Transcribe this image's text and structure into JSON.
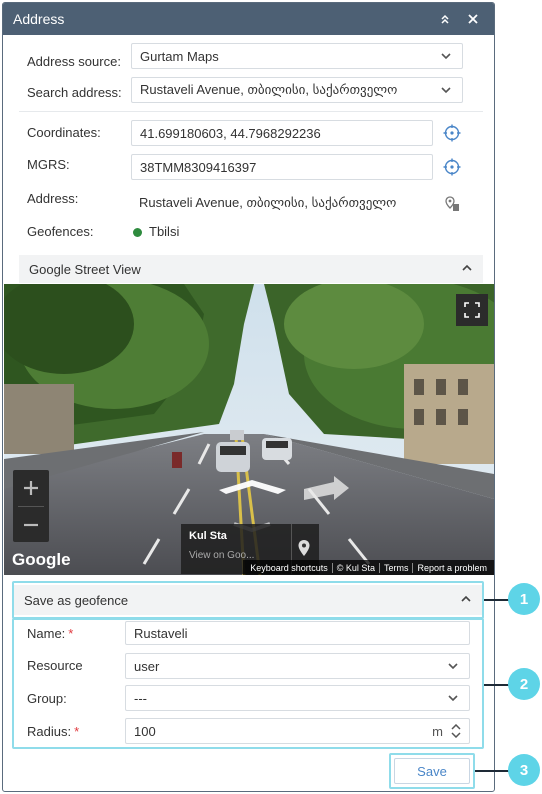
{
  "window": {
    "title": "Address"
  },
  "address_source": {
    "label": "Address source:",
    "value": "Gurtam Maps"
  },
  "search_address": {
    "label": "Search address:",
    "value": "Rustaveli Avenue, თბილისი, საქართველო"
  },
  "coordinates": {
    "label": "Coordinates:",
    "value": "41.699180603, 44.7968292236"
  },
  "mgrs": {
    "label": "MGRS:",
    "value": "38TMM8309416397"
  },
  "address": {
    "label": "Address:",
    "value": "Rustaveli Avenue, თბილისი, საქართველო"
  },
  "geofences": {
    "label": "Geofences:",
    "value": "Tbilsi",
    "dot_color": "#2e8b3e"
  },
  "street_view": {
    "header": "Google Street View",
    "place_name": "Kul Sta",
    "place_sub": "View on Goo...",
    "google_logo": "Google",
    "footer": [
      "Keyboard shortcuts",
      "© Kul Sta",
      "Terms",
      "Report a problem"
    ]
  },
  "geofence_panel": {
    "header": "Save as geofence",
    "name": {
      "label": "Name:",
      "value": "Rustaveli"
    },
    "resource": {
      "label": "Resource",
      "value": "user"
    },
    "group": {
      "label": "Group:",
      "value": "---"
    },
    "radius": {
      "label": "Radius:",
      "value": "100",
      "unit": "m"
    },
    "required_mark": "*"
  },
  "save_button": "Save",
  "callouts": [
    "1",
    "2",
    "3"
  ],
  "colors": {
    "titlebar": "#4d6074",
    "highlight": "#8fdcea",
    "callout": "#5ed4e7",
    "accent": "#4a86c8"
  }
}
